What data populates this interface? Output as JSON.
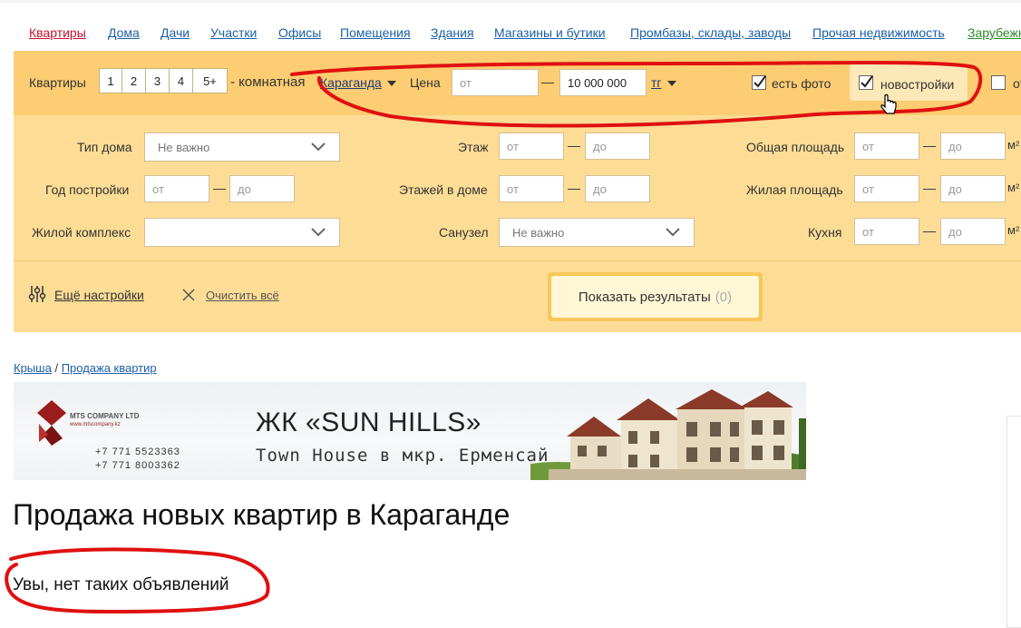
{
  "nav": {
    "items": [
      {
        "label": "Квартиры"
      },
      {
        "label": "Дома"
      },
      {
        "label": "Дачи"
      },
      {
        "label": "Участки"
      },
      {
        "label": "Офисы"
      },
      {
        "label": "Помещения"
      },
      {
        "label": "Здания"
      },
      {
        "label": "Магазины и бутики"
      },
      {
        "label": "Промбазы, склады, заводы"
      },
      {
        "label": "Прочая недвижимость"
      },
      {
        "label": "Зарубежн"
      }
    ]
  },
  "filter": {
    "apartments_label": "Квартиры",
    "rooms": [
      "1",
      "2",
      "3",
      "4",
      "5+"
    ],
    "rooms_suffix": "- комнатная",
    "city": "Караганда",
    "price_label": "Цена",
    "price_from_placeholder": "от",
    "price_to_value": "10 000 000",
    "currency": "тг",
    "has_photo_label": "есть фото",
    "has_photo_checked": true,
    "new_buildings_label": "новостройки",
    "new_buildings_checked": true,
    "extra_checkbox_label": "от",
    "house_type_label": "Тип дома",
    "house_type_value": "Не важно",
    "floor_label": "Этаж",
    "total_area_label": "Общая площадь",
    "build_year_label": "Год постройки",
    "floors_label": "Этажей в доме",
    "living_area_label": "Жилая площадь",
    "complex_label": "Жилой комплекс",
    "complex_value": "",
    "bathroom_label": "Санузел",
    "bathroom_value": "Не важно",
    "kitchen_label": "Кухня",
    "from_placeholder": "от",
    "to_placeholder": "до",
    "unit": "м²",
    "more_settings": "Ещё настройки",
    "clear_all": "Очистить всё",
    "show_results": "Показать результаты",
    "results_count": "(0)"
  },
  "breadcrumb": {
    "items": [
      "Крыша",
      "Продажа квартир"
    ],
    "separator": "/"
  },
  "banner": {
    "company": "MTS COMPANY LTD",
    "site": "www.mtscompany.kz",
    "phone1": "+7 771 5523363",
    "phone2": "+7 771 8003362",
    "title": "ЖК «SUN HILLS»",
    "subtitle": "Town House в мкр. Ерменсай"
  },
  "page": {
    "title": "Продажа новых квартир в Караганде",
    "empty_message": "Увы, нет таких объявлений"
  },
  "colors": {
    "filter_top": "#fccd72",
    "filter_body": "#fddd96",
    "link": "#1d5fa8",
    "active_link": "#c8102e",
    "annotation": "#e01010"
  }
}
